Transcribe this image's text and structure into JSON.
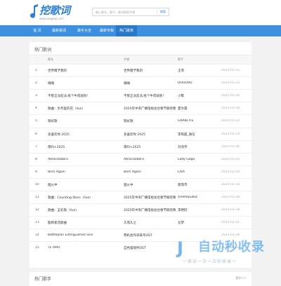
{
  "header": {
    "logo_text": "挖歌词",
    "logo_url": "www.wageqi.com",
    "search_placeholder": "输入歌名、歌手、歌词搜索专辑",
    "search_button": "搜索"
  },
  "nav": {
    "items": [
      "首 页",
      "最新歌词",
      "歌手大全",
      "最新专辑",
      "热门歌单"
    ],
    "active": 4
  },
  "hot_lyrics": {
    "title": "热门歌词",
    "columns": [
      "歌名",
      "专辑",
      "歌手"
    ],
    "rows": [
      {
        "num": "1",
        "song": "世界赠予我的",
        "album": "世界赠予我的",
        "artist": "王菲",
        "date": "2025-01-22"
      },
      {
        "num": "2",
        "song": "嗵嗵",
        "album": "嗵嗵",
        "artist": "DOUDOU",
        "date": "2025-01-23"
      },
      {
        "num": "3",
        "song": "不管正派反派,给个牛肉就别!",
        "album": "不管正派反派,给个牛肉就别!",
        "artist": "小鹭",
        "date": "2025-01-28"
      },
      {
        "num": "4",
        "song": "歌曲：岁月里的花（live）",
        "album": "2025年中央广播电视总台春节联欢晚会",
        "artist": "夏文雷",
        "date": "2025-01-28"
      },
      {
        "num": "5",
        "song": "铁好歌",
        "album": "铁好歌",
        "artist": "GRABCITE",
        "date": "2025-01-23"
      },
      {
        "num": "6",
        "song": "多喜欢你 2025",
        "album": "多喜欢你 2025",
        "artist": "李照晨_微信",
        "date": "2025-01-24"
      },
      {
        "num": "7",
        "song": "南吗+2025",
        "album": "南吗+2025",
        "artist": "刘兆宇",
        "date": "2025-01-26"
      },
      {
        "num": "8",
        "song": "Abracadabra",
        "album": "Abracadabra",
        "artist": "Lady Gaga",
        "date": "2025-02-03"
      },
      {
        "num": "9",
        "song": "Born Again",
        "album": "Born Again",
        "artist": "LISA",
        "date": "2025-02-03"
      },
      {
        "num": "10",
        "song": "烟火中",
        "album": "烟火中",
        "artist": "郁而市",
        "date": "2025-01-18"
      },
      {
        "num": "11",
        "song": "歌曲：Counting Stars（live）",
        "album": "2025年中央广播电视总台春节联欢晚会",
        "artist": "OneRepublic",
        "date": "2025-01-28"
      },
      {
        "num": "12",
        "song": "歌曲：五彩旗（live）",
        "album": "2025年中央广播电视总台春节联欢晚会",
        "artist": "李明轩",
        "date": "2025-01-28"
      },
      {
        "num": "13",
        "song": "脑目套话歌曲",
        "album": "久而久之",
        "artist": "吾梦",
        "date": "2025-02-01"
      },
      {
        "num": "14",
        "song": "Battleplan Extinguished Sins",
        "album": "恭机会作谛翠鸟OST",
        "artist": "",
        "date": "2025-01-28"
      },
      {
        "num": "15",
        "song": "TE AMO",
        "album": "自色理境时OST",
        "artist": "",
        "date": "2025-01-22"
      }
    ]
  },
  "hot_singers": {
    "title": "热门歌手",
    "more": "更多>>"
  },
  "watermark": {
    "text": "自动秒收录",
    "sub": "一来访一次一次秒收录一",
    "badge_letter": "J"
  },
  "colors": {
    "accent": "#3d8fe0",
    "nav_active": "#2a78c8",
    "logo": "#2f7fd4"
  }
}
